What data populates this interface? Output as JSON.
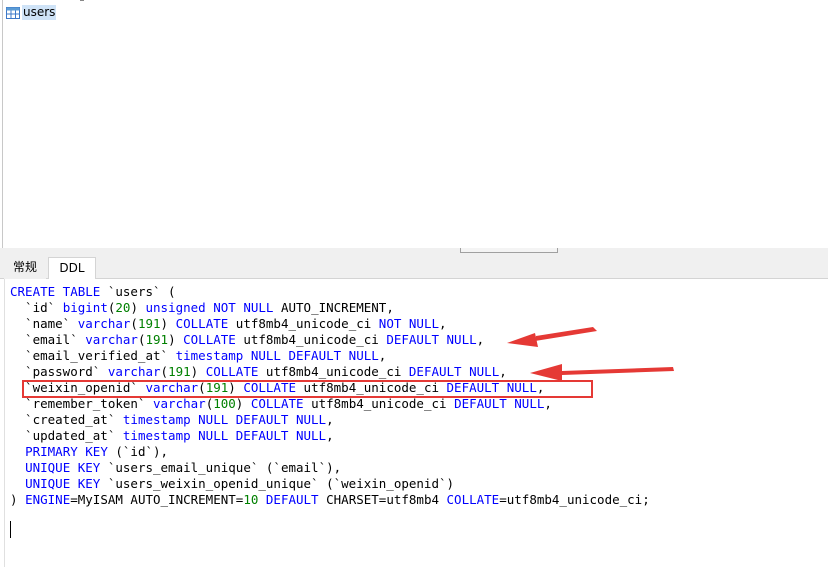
{
  "table_list": {
    "items": [
      {
        "label": "users",
        "icon": "table-icon"
      }
    ]
  },
  "tabs": [
    {
      "label": "常规",
      "active": false
    },
    {
      "label": "DDL",
      "active": true
    }
  ],
  "ddl": {
    "lines": [
      {
        "tokens": [
          {
            "t": "CREATE TABLE",
            "k": "kw"
          },
          {
            "t": " `users` (",
            "k": "plain"
          }
        ]
      },
      {
        "tokens": [
          {
            "t": "  `id` ",
            "k": "plain"
          },
          {
            "t": "bigint",
            "k": "kw"
          },
          {
            "t": "(",
            "k": "plain"
          },
          {
            "t": "20",
            "k": "num"
          },
          {
            "t": ") ",
            "k": "plain"
          },
          {
            "t": "unsigned NOT NULL",
            "k": "kw"
          },
          {
            "t": " AUTO_INCREMENT,",
            "k": "plain"
          }
        ]
      },
      {
        "tokens": [
          {
            "t": "  `name` ",
            "k": "plain"
          },
          {
            "t": "varchar",
            "k": "kw"
          },
          {
            "t": "(",
            "k": "plain"
          },
          {
            "t": "191",
            "k": "num"
          },
          {
            "t": ") ",
            "k": "plain"
          },
          {
            "t": "COLLATE",
            "k": "kw"
          },
          {
            "t": " utf8mb4_unicode_ci ",
            "k": "plain"
          },
          {
            "t": "NOT NULL",
            "k": "kw"
          },
          {
            "t": ",",
            "k": "plain"
          }
        ]
      },
      {
        "tokens": [
          {
            "t": "  `email` ",
            "k": "plain"
          },
          {
            "t": "varchar",
            "k": "kw"
          },
          {
            "t": "(",
            "k": "plain"
          },
          {
            "t": "191",
            "k": "num"
          },
          {
            "t": ") ",
            "k": "plain"
          },
          {
            "t": "COLLATE",
            "k": "kw"
          },
          {
            "t": " utf8mb4_unicode_ci ",
            "k": "plain"
          },
          {
            "t": "DEFAULT NULL",
            "k": "kw"
          },
          {
            "t": ",",
            "k": "plain"
          }
        ]
      },
      {
        "tokens": [
          {
            "t": "  `email_verified_at` ",
            "k": "plain"
          },
          {
            "t": "timestamp NULL DEFAULT NULL",
            "k": "kw"
          },
          {
            "t": ",",
            "k": "plain"
          }
        ]
      },
      {
        "tokens": [
          {
            "t": "  `password` ",
            "k": "plain"
          },
          {
            "t": "varchar",
            "k": "kw"
          },
          {
            "t": "(",
            "k": "plain"
          },
          {
            "t": "191",
            "k": "num"
          },
          {
            "t": ") ",
            "k": "plain"
          },
          {
            "t": "COLLATE",
            "k": "kw"
          },
          {
            "t": " utf8mb4_unicode_ci ",
            "k": "plain"
          },
          {
            "t": "DEFAULT NULL",
            "k": "kw"
          },
          {
            "t": ",",
            "k": "plain"
          }
        ]
      },
      {
        "tokens": [
          {
            "t": "  `weixin_openid` ",
            "k": "plain"
          },
          {
            "t": "varchar",
            "k": "kw"
          },
          {
            "t": "(",
            "k": "plain"
          },
          {
            "t": "191",
            "k": "num"
          },
          {
            "t": ") ",
            "k": "plain"
          },
          {
            "t": "COLLATE",
            "k": "kw"
          },
          {
            "t": " utf8mb4_unicode_ci ",
            "k": "plain"
          },
          {
            "t": "DEFAULT NULL",
            "k": "kw"
          },
          {
            "t": ",",
            "k": "plain"
          }
        ]
      },
      {
        "tokens": [
          {
            "t": "  `remember_token` ",
            "k": "plain"
          },
          {
            "t": "varchar",
            "k": "kw"
          },
          {
            "t": "(",
            "k": "plain"
          },
          {
            "t": "100",
            "k": "num"
          },
          {
            "t": ") ",
            "k": "plain"
          },
          {
            "t": "COLLATE",
            "k": "kw"
          },
          {
            "t": " utf8mb4_unicode_ci ",
            "k": "plain"
          },
          {
            "t": "DEFAULT NULL",
            "k": "kw"
          },
          {
            "t": ",",
            "k": "plain"
          }
        ]
      },
      {
        "tokens": [
          {
            "t": "  `created_at` ",
            "k": "plain"
          },
          {
            "t": "timestamp NULL DEFAULT NULL",
            "k": "kw"
          },
          {
            "t": ",",
            "k": "plain"
          }
        ]
      },
      {
        "tokens": [
          {
            "t": "  `updated_at` ",
            "k": "plain"
          },
          {
            "t": "timestamp NULL DEFAULT NULL",
            "k": "kw"
          },
          {
            "t": ",",
            "k": "plain"
          }
        ]
      },
      {
        "tokens": [
          {
            "t": "  ",
            "k": "plain"
          },
          {
            "t": "PRIMARY KEY",
            "k": "kw"
          },
          {
            "t": " (`id`),",
            "k": "plain"
          }
        ]
      },
      {
        "tokens": [
          {
            "t": "  ",
            "k": "plain"
          },
          {
            "t": "UNIQUE KEY",
            "k": "kw"
          },
          {
            "t": " `users_email_unique` (`email`),",
            "k": "plain"
          }
        ]
      },
      {
        "tokens": [
          {
            "t": "  ",
            "k": "plain"
          },
          {
            "t": "UNIQUE KEY",
            "k": "kw"
          },
          {
            "t": " `users_weixin_openid_unique` (`weixin_openid`)",
            "k": "plain"
          }
        ]
      },
      {
        "tokens": [
          {
            "t": ") ",
            "k": "plain"
          },
          {
            "t": "ENGINE",
            "k": "kw"
          },
          {
            "t": "=MyISAM AUTO_INCREMENT=",
            "k": "plain"
          },
          {
            "t": "10",
            "k": "num"
          },
          {
            "t": " ",
            "k": "plain"
          },
          {
            "t": "DEFAULT",
            "k": "kw"
          },
          {
            "t": " CHARSET=utf8mb4 ",
            "k": "plain"
          },
          {
            "t": "COLLATE",
            "k": "kw"
          },
          {
            "t": "=utf8mb4_unicode_ci;",
            "k": "plain"
          }
        ]
      }
    ]
  },
  "colors": {
    "keyword": "#0000ff",
    "number": "#008000",
    "annotation": "#e53935",
    "selection": "#cfe3f7"
  }
}
